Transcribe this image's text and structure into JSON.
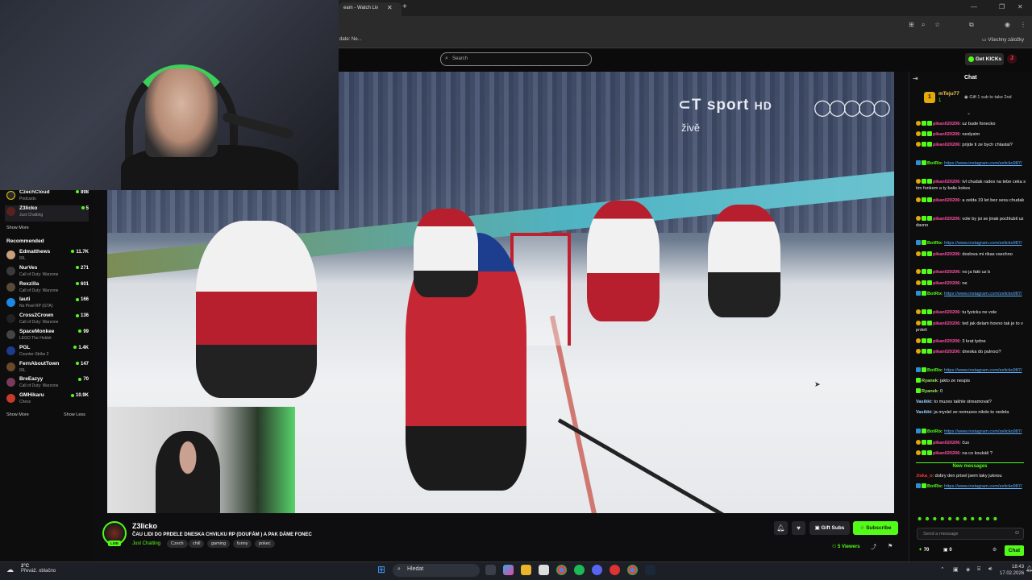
{
  "browser": {
    "tab_title": "eam - Watch Liv",
    "bookmark_partial": "date: Ne...",
    "bookmarks_all": "Všechny záložky"
  },
  "header": {
    "search_placeholder": "Search",
    "get_kicks": "Get KICKs",
    "user_initial": "J"
  },
  "sidebar": {
    "following": [
      {
        "name": "CzechCloud",
        "category": "Podcasts",
        "viewers": "898"
      },
      {
        "name": "Z3licko",
        "category": "Just Chatting",
        "viewers": "5"
      }
    ],
    "show_more_1": "Show More",
    "recommended_heading": "Recommended",
    "recommended": [
      {
        "name": "Edmatthews",
        "category": "IRL",
        "viewers": "11.7K"
      },
      {
        "name": "NurVes",
        "category": "Call of Duty: Warzone",
        "viewers": "271"
      },
      {
        "name": "Rexzilla",
        "category": "Call of Duty: Warzone",
        "viewers": "601"
      },
      {
        "name": "lauti",
        "category": "No Pixel RP (GTA)",
        "viewers": "166"
      },
      {
        "name": "Cross2Crown",
        "category": "Call of Duty: Warzone",
        "viewers": "136"
      },
      {
        "name": "SpaceMonkee",
        "category": "LEGO The Hobbit",
        "viewers": "99"
      },
      {
        "name": "PGL",
        "category": "Counter-Strike 2",
        "viewers": "1.4K"
      },
      {
        "name": "FernAboutTown",
        "category": "IRL",
        "viewers": "147"
      },
      {
        "name": "BreEazyy",
        "category": "Call of Duty: Warzone",
        "viewers": "70"
      },
      {
        "name": "GMHikaru",
        "category": "Chess",
        "viewers": "10.9K"
      }
    ],
    "show_more_2": "Show More",
    "show_less": "Show Less"
  },
  "video": {
    "broadcaster_logo": "sport",
    "broadcaster_hd": "HD",
    "live_label": "živě"
  },
  "stream": {
    "streamer": "Z3licko",
    "title": "ČAU LIDI DO PRDELE DNESKA CHVILKU RP (DOUFÁM ) A PAK DÁME FONEC",
    "category": "Just Chatting",
    "tags": [
      "Czech",
      "chill",
      "gaming",
      "funny",
      "pokec"
    ],
    "live": "LIVE",
    "gift_subs": "Gift Subs",
    "subscribe": "Subscribe",
    "viewers": "5 Viewers"
  },
  "chat": {
    "title": "Chat",
    "pinned": {
      "user": "mTeju77",
      "count": "1",
      "gift_text": "Gift 1 sub to take 2nd"
    },
    "messages": [
      {
        "user": "pikan020206",
        "text": "uz bude fonecko",
        "style": "pink"
      },
      {
        "user": "pikan020206",
        "text": "neslysim",
        "style": "pink"
      },
      {
        "user": "pikan020206",
        "text": "prijde ti ze bych chlastal?",
        "style": "pink"
      },
      {
        "user": "BotRix",
        "text": "https://www.instagram.com/zelicko987/",
        "style": "bot"
      },
      {
        "user": "pikan020206",
        "text": "tvl chudak rades na tebe ceka s tim fonkem a ty balis kokes",
        "style": "pink"
      },
      {
        "user": "pikan020206",
        "text": "a zelda 19 let bez sexu chudak",
        "style": "pink"
      },
      {
        "user": "pikan020206",
        "text": "vole by jsi se jinak pochlubil uz davno",
        "style": "pink"
      },
      {
        "user": "BotRix",
        "text": "https://www.instagram.com/zelicko987/",
        "style": "bot"
      },
      {
        "user": "pikan020206",
        "text": "doslova mi rikas vsechno",
        "style": "pink"
      },
      {
        "user": "pikan020206",
        "text": "no ja fakt uz b",
        "style": "pink"
      },
      {
        "user": "pikan020206",
        "text": "ne",
        "style": "pink"
      },
      {
        "user": "BotRix",
        "text": "https://www.instagram.com/zelicko987/",
        "style": "bot"
      },
      {
        "user": "pikan020206",
        "text": "tu fyzicku ne vole",
        "style": "pink"
      },
      {
        "user": "pikan020206",
        "text": "ted jak delam hovno tak je to v prdeli",
        "style": "pink"
      },
      {
        "user": "pikan020206",
        "text": "3 krat tydne",
        "style": "pink"
      },
      {
        "user": "pikan020206",
        "text": "dneska do pulnoci?",
        "style": "pink"
      },
      {
        "user": "BotRix",
        "text": "https://www.instagram.com/zelicko987/",
        "style": "bot"
      },
      {
        "user": "Ryanek",
        "text": "jakto ze nespis",
        "style": "ry"
      },
      {
        "user": "Ryanek",
        "text": "0",
        "style": "ry"
      },
      {
        "user": "Vasikkt",
        "text": "to muzes takhle streamovat?",
        "style": "va"
      },
      {
        "user": "Vasikkt",
        "text": "ja myslel ze nemuzes nikdo to nedela",
        "style": "va"
      },
      {
        "user": "BotRix",
        "text": "https://www.instagram.com/zelicko987/",
        "style": "bot"
      },
      {
        "user": "pikan020206",
        "text": "čus",
        "style": "pink"
      },
      {
        "user": "pikan020206",
        "text": "na co koukáš ?",
        "style": "pink"
      }
    ],
    "new_messages": "New messages",
    "new": [
      {
        "user": "Jiska_o",
        "text": "dobry den prisel jsem taky juknou",
        "style": "ji"
      },
      {
        "user": "BotRix",
        "text": "https://www.instagram.com/zelicko987/",
        "style": "bot"
      }
    ],
    "input_placeholder": "Send a message",
    "kicks_count": "70",
    "subs_count": "0",
    "send": "Chat"
  },
  "taskbar": {
    "temperature": "2°C",
    "weather": "Převáž. oblačno",
    "search": "Hledat",
    "time": "18:43",
    "date": "17.02.2026"
  }
}
